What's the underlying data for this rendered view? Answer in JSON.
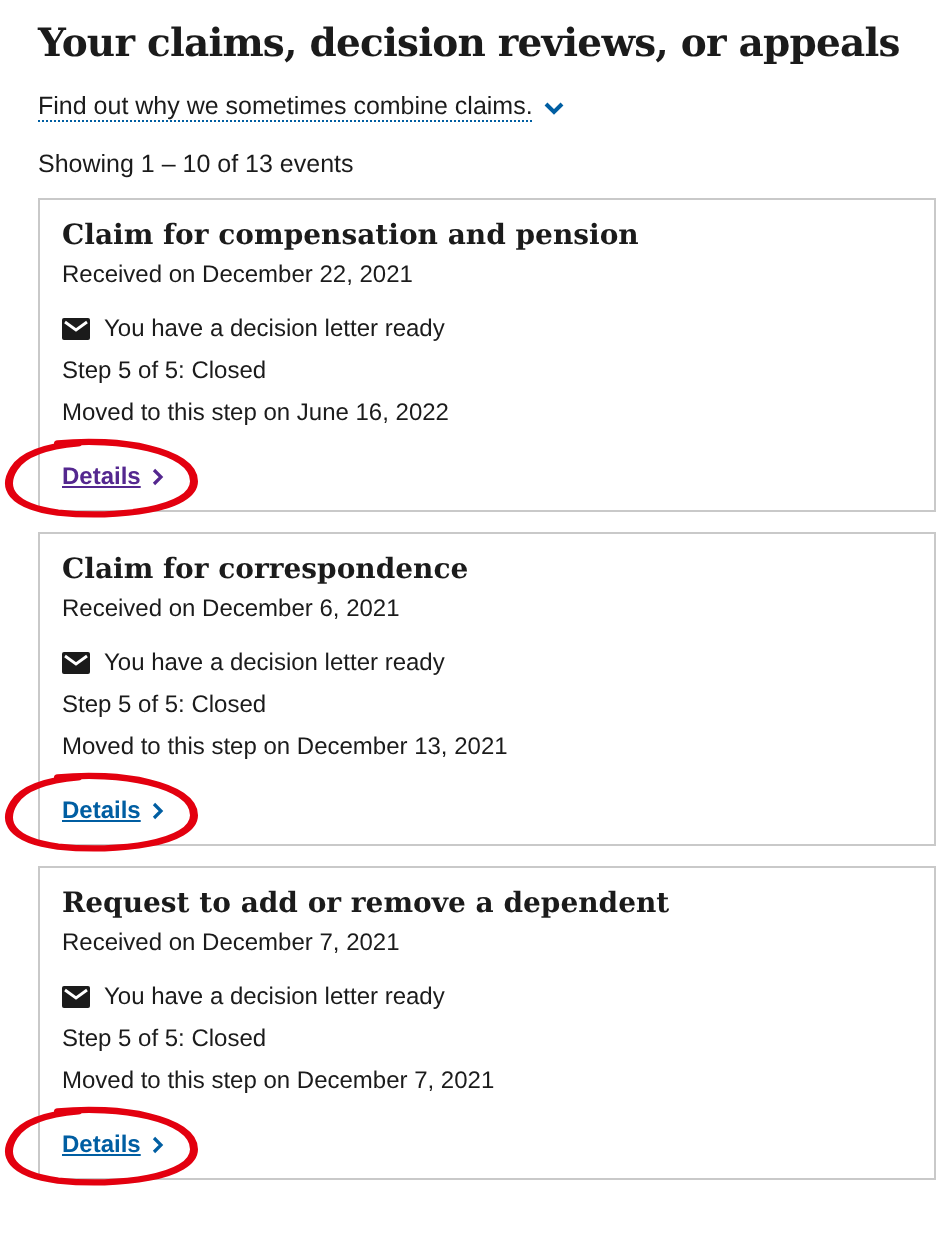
{
  "heading": "Your claims, decision reviews, or appeals",
  "info_link": {
    "label": "Find out why we sometimes combine claims.",
    "expanded": false
  },
  "summary": "Showing 1 – 10 of 13 events",
  "claims": [
    {
      "title": "Claim for compensation and pension",
      "received": "Received on December 22, 2021",
      "notice": "You have a decision letter ready",
      "step": "Step 5 of 5: Closed",
      "moved": "Moved to this step on June 16, 2022",
      "link": "Details",
      "visited": true,
      "circled": true
    },
    {
      "title": "Claim for correspondence",
      "received": "Received on December 6, 2021",
      "notice": "You have a decision letter ready",
      "step": "Step 5 of 5: Closed",
      "moved": "Moved to this step on December 13, 2021",
      "link": "Details",
      "visited": false,
      "circled": true
    },
    {
      "title": "Request to add or remove a dependent",
      "received": "Received on December 7, 2021",
      "notice": "You have a decision letter ready",
      "step": "Step 5 of 5: Closed",
      "moved": "Moved to this step on December 7, 2021",
      "link": "Details",
      "visited": false,
      "circled": true
    }
  ]
}
